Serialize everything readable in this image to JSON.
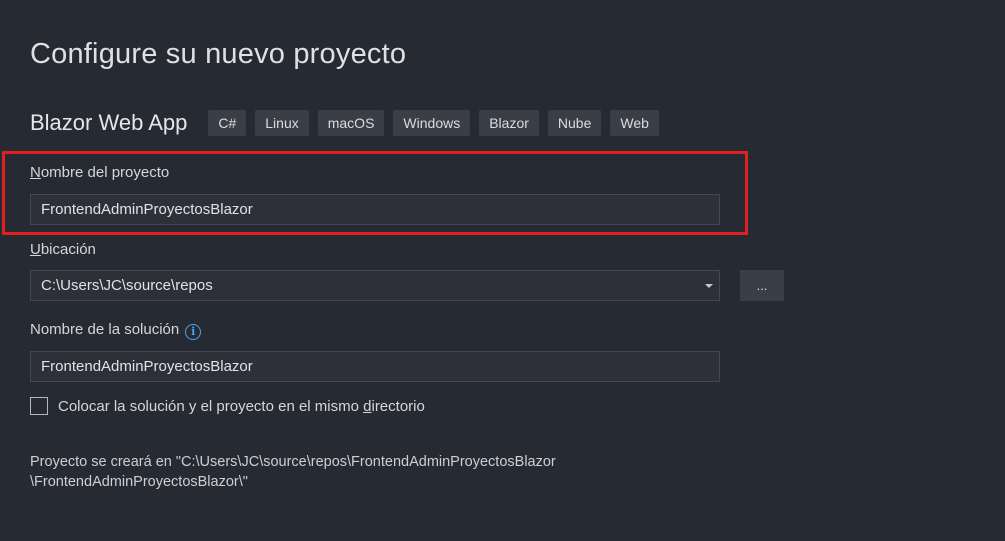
{
  "header": {
    "title": "Configure su nuevo proyecto"
  },
  "template": {
    "name": "Blazor Web App",
    "tags": [
      "C#",
      "Linux",
      "macOS",
      "Windows",
      "Blazor",
      "Nube",
      "Web"
    ]
  },
  "project_name": {
    "label_accel": "N",
    "label_rest": "ombre del proyecto",
    "value": "FrontendAdminProyectosBlazor"
  },
  "location": {
    "label_accel": "U",
    "label_rest": "bicación",
    "value": "C:\\Users\\JC\\source\\repos",
    "browse_label": "..."
  },
  "solution_name": {
    "label": "Nombre de la solución",
    "value": "FrontendAdminProyectosBlazor",
    "info_icon": "info-icon"
  },
  "same_directory": {
    "label_before": "Colocar la solución y el proyecto en el mismo ",
    "label_accel": "d",
    "label_after": "irectorio",
    "checked": false
  },
  "path_note": {
    "line1": "Proyecto se creará en \"C:\\Users\\JC\\source\\repos\\FrontendAdminProyectosBlazor",
    "line2": "\\FrontendAdminProyectosBlazor\\\""
  },
  "colors": {
    "background": "#262a33",
    "highlight": "#e01f20",
    "info_accent": "#4aa0f0"
  }
}
